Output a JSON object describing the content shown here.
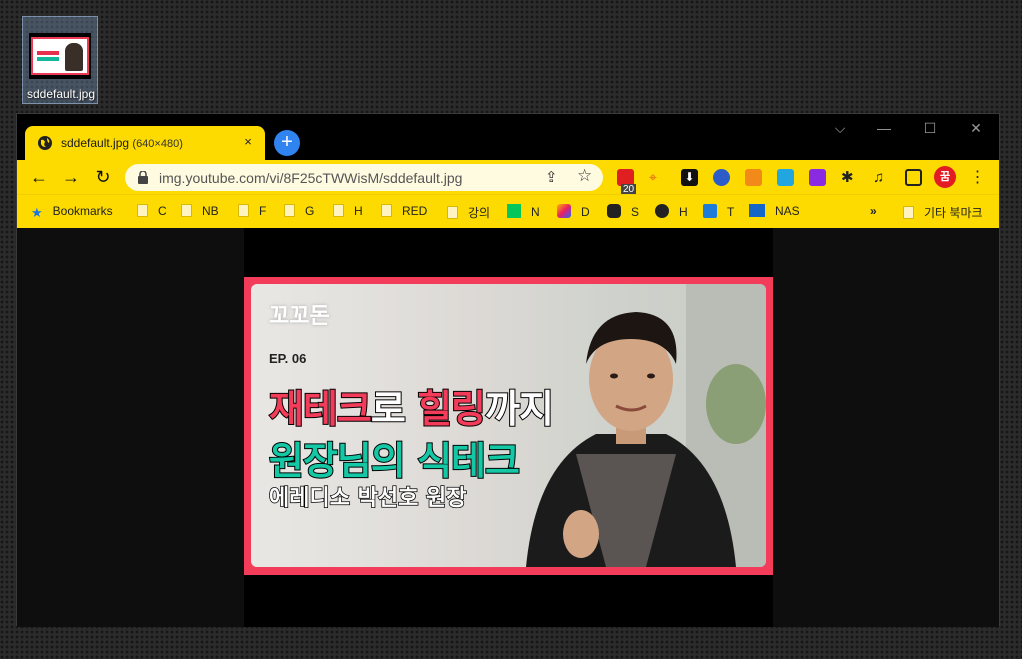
{
  "desktop": {
    "icon_label": "sddefault.jpg"
  },
  "tab": {
    "title": "sddefault.jpg",
    "dims": "(640×480)",
    "close": "×",
    "new_tab": "+"
  },
  "window_controls": {
    "minimize": "—",
    "maximize": "☐",
    "close": "✕",
    "chevron": "⌵"
  },
  "toolbar": {
    "url": "img.youtube.com/vi/8F25cTWWisM/sddefault.jpg",
    "back": "←",
    "forward": "→",
    "reload": "↻",
    "ext_badge": "20",
    "profile_label": "꿈"
  },
  "bookmarks": {
    "items": [
      {
        "label": "Bookmarks"
      },
      {
        "label": "C"
      },
      {
        "label": "NB"
      },
      {
        "label": "F"
      },
      {
        "label": "G"
      },
      {
        "label": "H"
      },
      {
        "label": "RED"
      },
      {
        "label": "강의"
      },
      {
        "label": "N"
      },
      {
        "label": "D"
      },
      {
        "label": "S"
      },
      {
        "label": "H"
      },
      {
        "label": "T"
      },
      {
        "label": "NAS"
      }
    ],
    "overflow": "»",
    "other": "기타 북마크"
  },
  "image": {
    "logo": "꼬꼬돈",
    "episode": "EP. 06",
    "headline1_pink1": "재테크",
    "headline1_white1": "로 ",
    "headline1_pink2": "힐링",
    "headline1_white2": "까지",
    "headline2": "원장님의 식테크",
    "guest": "에레디소 박선호 원장"
  },
  "colors": {
    "browser_accent": "#fddb00",
    "thumb_border": "#f23c5a",
    "teal": "#14c8a6"
  }
}
